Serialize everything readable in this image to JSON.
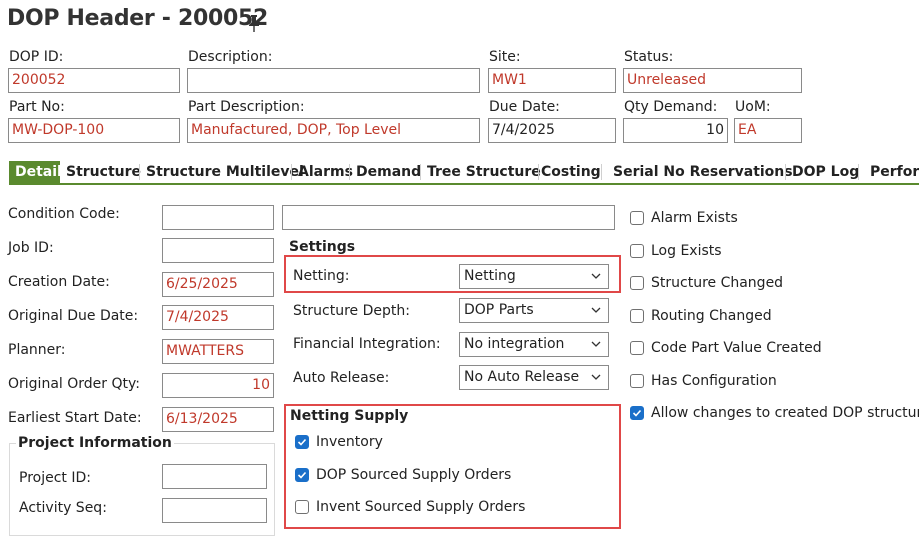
{
  "header": {
    "title": "DOP Header - 200052",
    "pin_icon": "pin-icon"
  },
  "fields": {
    "dop_id": {
      "label": "DOP ID:",
      "value": "200052"
    },
    "description": {
      "label": "Description:",
      "value": ""
    },
    "site": {
      "label": "Site:",
      "value": "MW1"
    },
    "status": {
      "label": "Status:",
      "value": "Unreleased"
    },
    "part_no": {
      "label": "Part No:",
      "value": "MW-DOP-100"
    },
    "part_description": {
      "label": "Part Description:",
      "value": "Manufactured, DOP, Top Level"
    },
    "due_date": {
      "label": "Due Date:",
      "value": "7/4/2025"
    },
    "qty_demand": {
      "label": "Qty Demand:",
      "value": "10"
    },
    "uom": {
      "label": "UoM:",
      "value": "EA"
    }
  },
  "tabs": [
    {
      "label": "Detail",
      "active": true
    },
    {
      "label": "Structure"
    },
    {
      "label": "Structure Multilevel"
    },
    {
      "label": "Alarms"
    },
    {
      "label": "Demand"
    },
    {
      "label": "Tree Structure"
    },
    {
      "label": "Costing"
    },
    {
      "label": "Serial No Reservations"
    },
    {
      "label": "DOP Log"
    },
    {
      "label": "Perfor"
    }
  ],
  "detail": {
    "condition_code": {
      "label": "Condition Code:",
      "value": "",
      "desc": ""
    },
    "job_id": {
      "label": "Job ID:",
      "value": ""
    },
    "creation_date": {
      "label": "Creation Date:",
      "value": "6/25/2025"
    },
    "original_due_date": {
      "label": "Original Due Date:",
      "value": "7/4/2025"
    },
    "planner": {
      "label": "Planner:",
      "value": "MWATTERS"
    },
    "original_order_qty": {
      "label": "Original Order Qty:",
      "value": "10"
    },
    "earliest_start_date": {
      "label": "Earliest Start Date:",
      "value": "6/13/2025"
    }
  },
  "project": {
    "title": "Project Information",
    "project_id": {
      "label": "Project ID:",
      "value": ""
    },
    "activity_seq": {
      "label": "Activity Seq:",
      "value": ""
    }
  },
  "settings": {
    "title": "Settings",
    "netting": {
      "label": "Netting:",
      "value": "Netting"
    },
    "structure_depth": {
      "label": "Structure Depth:",
      "value": "DOP Parts"
    },
    "financial_integration": {
      "label": "Financial Integration:",
      "value": "No integration"
    },
    "auto_release": {
      "label": "Auto Release:",
      "value": "No Auto Release"
    }
  },
  "netting_supply": {
    "title": "Netting Supply",
    "inventory": {
      "label": "Inventory",
      "checked": true
    },
    "dop_sourced": {
      "label": "DOP Sourced Supply Orders",
      "checked": true
    },
    "invent_sourced": {
      "label": "Invent Sourced Supply Orders",
      "checked": false
    }
  },
  "flags": {
    "alarm_exists": {
      "label": "Alarm Exists",
      "checked": false
    },
    "log_exists": {
      "label": "Log Exists",
      "checked": false
    },
    "structure_changed": {
      "label": "Structure Changed",
      "checked": false
    },
    "routing_changed": {
      "label": "Routing Changed",
      "checked": false
    },
    "code_part_value_created": {
      "label": "Code Part Value Created",
      "checked": false
    },
    "has_configuration": {
      "label": "Has Configuration",
      "checked": false
    },
    "allow_changes": {
      "label": "Allow changes to created DOP structure",
      "checked": true
    }
  },
  "colors": {
    "accent_green": "#5a8a2e",
    "value_red": "#c0392b",
    "highlight_red": "#e04848",
    "check_blue": "#1a6fc9"
  }
}
